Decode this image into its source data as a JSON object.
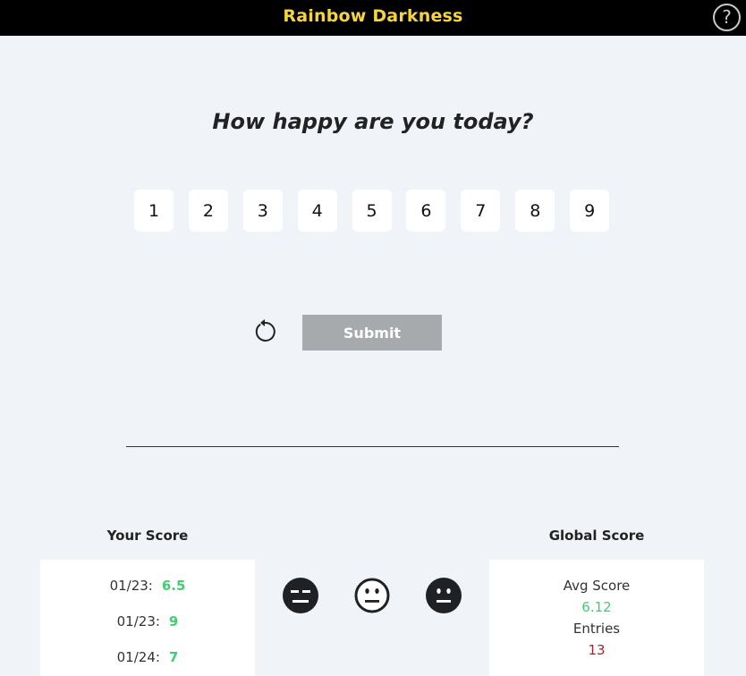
{
  "header": {
    "title": "Rainbow Darkness",
    "help_label": "?"
  },
  "question": "How happy are you today?",
  "scale": [
    "1",
    "2",
    "3",
    "4",
    "5",
    "6",
    "7",
    "8",
    "9"
  ],
  "actions": {
    "submit_label": "Submit",
    "reset_icon": "reset-icon"
  },
  "divider_text": "",
  "your_score": {
    "heading": "Your Score",
    "entries": [
      {
        "date": "01/23:",
        "score": "6.5"
      },
      {
        "date": "01/23:",
        "score": "9"
      },
      {
        "date": "01/24:",
        "score": "7"
      }
    ]
  },
  "moods": [
    "mood-expressionless-icon",
    "mood-neutral-outline-icon",
    "mood-neutral-filled-icon"
  ],
  "global_score": {
    "heading": "Global Score",
    "avg_label": "Avg Score",
    "avg_value": "6.12",
    "entries_label": "Entries",
    "entries_value": "13"
  },
  "colors": {
    "title": "#f7d33c",
    "score_value": "#3fcf6d",
    "avg_value": "#3fcf6d",
    "entries_value": "#a0282f",
    "submit_bg": "#a6aaad",
    "background": "#f0f3f8"
  }
}
